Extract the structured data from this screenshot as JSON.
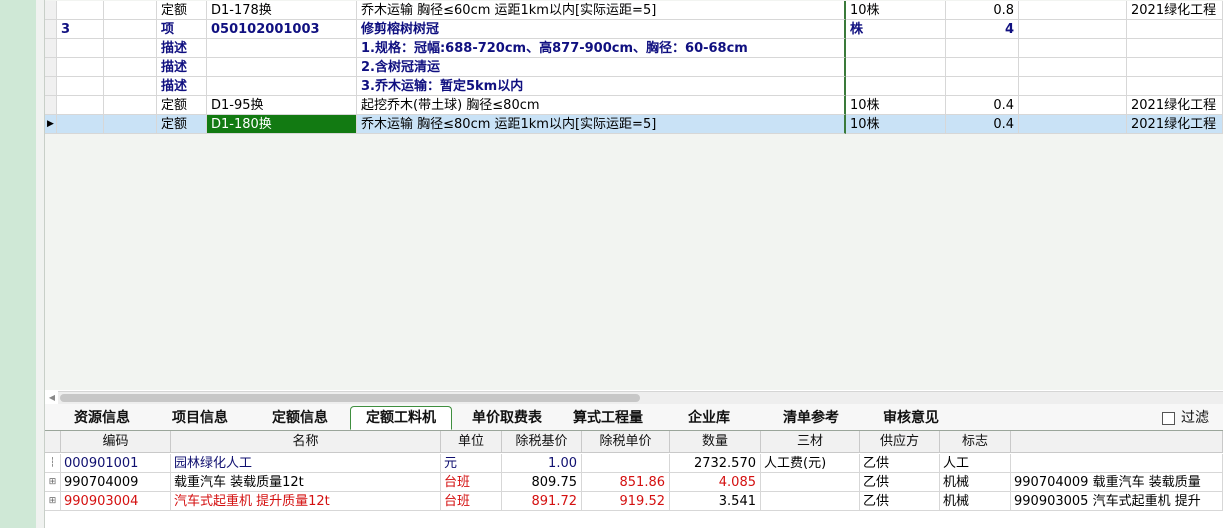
{
  "upper_rows": [
    {
      "c1": "",
      "c2": "",
      "c3": "定额",
      "c4": "D1-178换",
      "c5": "乔木运输 胸径≤60cm 运距1km以内[实际运距=5]",
      "c6": "10株",
      "c7": "0.8",
      "c8": "",
      "c9": "2021绿化工程"
    },
    {
      "c1": "3",
      "c2": "",
      "c3": "项",
      "c4": "050102001003",
      "c5": "修剪榕树树冠",
      "c6": "株",
      "c7": "4",
      "c8": "",
      "c9": ""
    },
    {
      "c1": "",
      "c2": "",
      "c3": "描述",
      "c4": "",
      "c5": "1.规格：冠幅:688-720cm、高877-900cm、胸径：60-68cm",
      "c6": "",
      "c7": "",
      "c8": "",
      "c9": ""
    },
    {
      "c1": "",
      "c2": "",
      "c3": "描述",
      "c4": "",
      "c5": "2.含树冠清运",
      "c6": "",
      "c7": "",
      "c8": "",
      "c9": ""
    },
    {
      "c1": "",
      "c2": "",
      "c3": "描述",
      "c4": "",
      "c5": "3.乔木运输：暂定5km以内",
      "c6": "",
      "c7": "",
      "c8": "",
      "c9": ""
    },
    {
      "c1": "",
      "c2": "",
      "c3": "定额",
      "c4": "D1-95换",
      "c5": "起挖乔木(带土球) 胸径≤80cm",
      "c6": "10株",
      "c7": "0.4",
      "c8": "",
      "c9": "2021绿化工程"
    },
    {
      "c1": "",
      "c2": "",
      "c3": "定额",
      "c4": "D1-180换",
      "c5": "乔木运输 胸径≤80cm 运距1km以内[实际运距=5]",
      "c6": "10株",
      "c7": "0.4",
      "c8": "",
      "c9": "2021绿化工程"
    }
  ],
  "tabs": [
    "资源信息",
    "项目信息",
    "定额信息",
    "定额工料机",
    "单价取费表",
    "算式工程量",
    "企业库",
    "清单参考",
    "审核意见"
  ],
  "active_tab": "定额工料机",
  "filter_label": "过滤",
  "lower_headers": [
    "编码",
    "名称",
    "单位",
    "除税基价",
    "除税单价",
    "数量",
    "三材",
    "供应方",
    "标志",
    ""
  ],
  "lower_rows": [
    {
      "code": "000901001",
      "name": "园林绿化人工",
      "unit": "元",
      "base": "1.00",
      "price": "",
      "qty": "2732.570",
      "sancai": "人工费(元)",
      "supplier": "乙供",
      "flag": "人工",
      "extra": ""
    },
    {
      "code": "990704009",
      "name": "载重汽车 装载质量12t",
      "unit": "台班",
      "base": "809.75",
      "price": "851.86",
      "qty": "4.085",
      "sancai": "",
      "supplier": "乙供",
      "flag": "机械",
      "extra": "990704009  载重汽车 装载质量"
    },
    {
      "code": "990903004",
      "name": "汽车式起重机 提升质量12t",
      "unit": "台班",
      "base": "891.72",
      "price": "919.52",
      "qty": "3.541",
      "sancai": "",
      "supplier": "乙供",
      "flag": "机械",
      "extra": "990903005  汽车式起重机 提升"
    }
  ],
  "icons": {
    "row_pointer": "triangle-right-icon",
    "expand": "plus-box-icon",
    "checkbox": "checkbox-icon",
    "scroll_left": "arrow-left-icon"
  }
}
